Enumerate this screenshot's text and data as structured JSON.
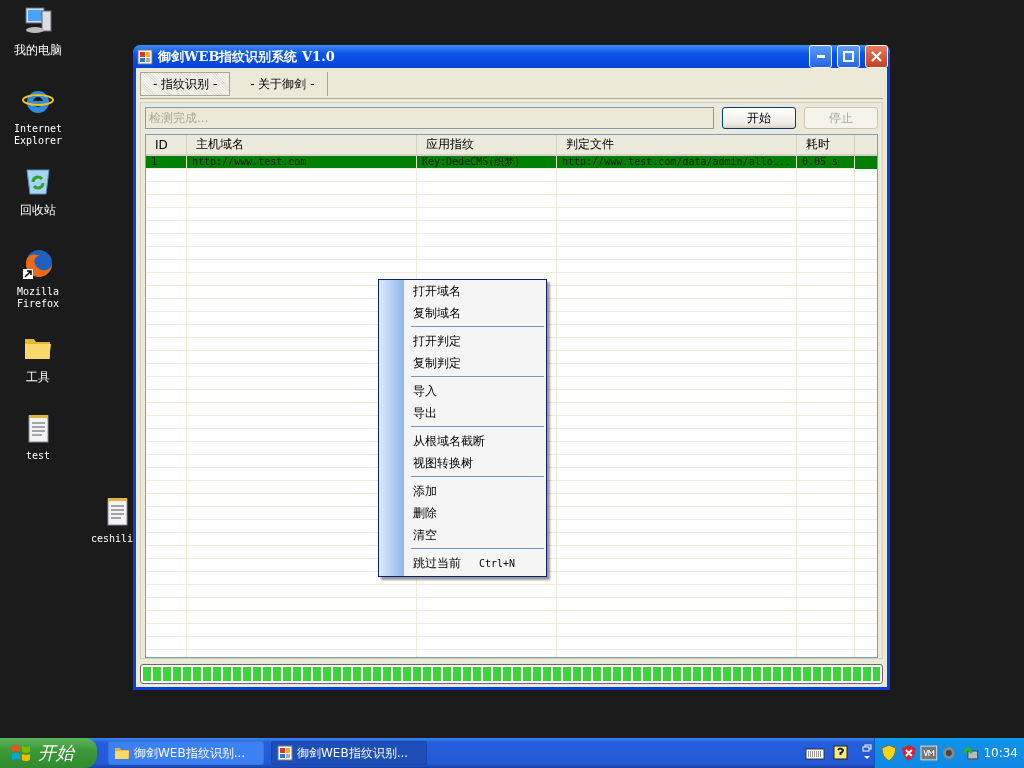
{
  "desktop_icons": [
    {
      "label": "我的电脑",
      "kind": "computer"
    },
    {
      "label": "Internet Explorer",
      "kind": "browser"
    },
    {
      "label": "回收站",
      "kind": "recycle"
    },
    {
      "label": "Mozilla Firefox",
      "kind": "firefox"
    },
    {
      "label": "工具",
      "kind": "folder"
    },
    {
      "label": "test",
      "kind": "notepad"
    },
    {
      "label": "ceshili",
      "kind": "notepad"
    }
  ],
  "window": {
    "title": "御剑WEB指纹识别系统 V1.0",
    "tabs": [
      {
        "label": "- 指纹识别 -",
        "selected": true
      },
      {
        "label": "- 关于御剑 -",
        "selected": false
      }
    ],
    "target_field": {
      "value": "检测完成...",
      "disabled": true
    },
    "buttons": [
      {
        "label": "开始",
        "disabled": false
      },
      {
        "label": "停止",
        "disabled": true
      }
    ],
    "table": {
      "columns": [
        "ID",
        "主机域名",
        "应用指纹",
        "判定文件",
        "耗时"
      ],
      "rows": [
        {
          "cells": [
            "1",
            "http://www.test.com",
            "Key:DedeCMS(织梦)",
            "http://www.test.com/data/admin/allo...",
            "0.05 s"
          ],
          "selected": true
        }
      ]
    },
    "progress": {
      "level": 1
    }
  },
  "context_menu": {
    "groups": [
      [
        {
          "label": "打开域名"
        },
        {
          "label": "复制域名"
        }
      ],
      [
        {
          "label": "打开判定"
        },
        {
          "label": "复制判定"
        }
      ],
      [
        {
          "label": "导入"
        },
        {
          "label": "导出"
        }
      ],
      [
        {
          "label": "从根域名截断"
        },
        {
          "label": "视图转换树"
        }
      ],
      [
        {
          "label": "添加"
        },
        {
          "label": "删除"
        },
        {
          "label": "清空"
        }
      ],
      [
        {
          "label": "跳过当前",
          "shortcut": "Ctrl+N"
        }
      ]
    ]
  },
  "taskbar": {
    "start": "开始",
    "tasks": [
      {
        "label": "御剑WEB指纹识别...",
        "kind": "folder",
        "active": false
      },
      {
        "label": "御剑WEB指纹识别...",
        "kind": "app",
        "active": true
      }
    ],
    "clock": "10:34"
  }
}
